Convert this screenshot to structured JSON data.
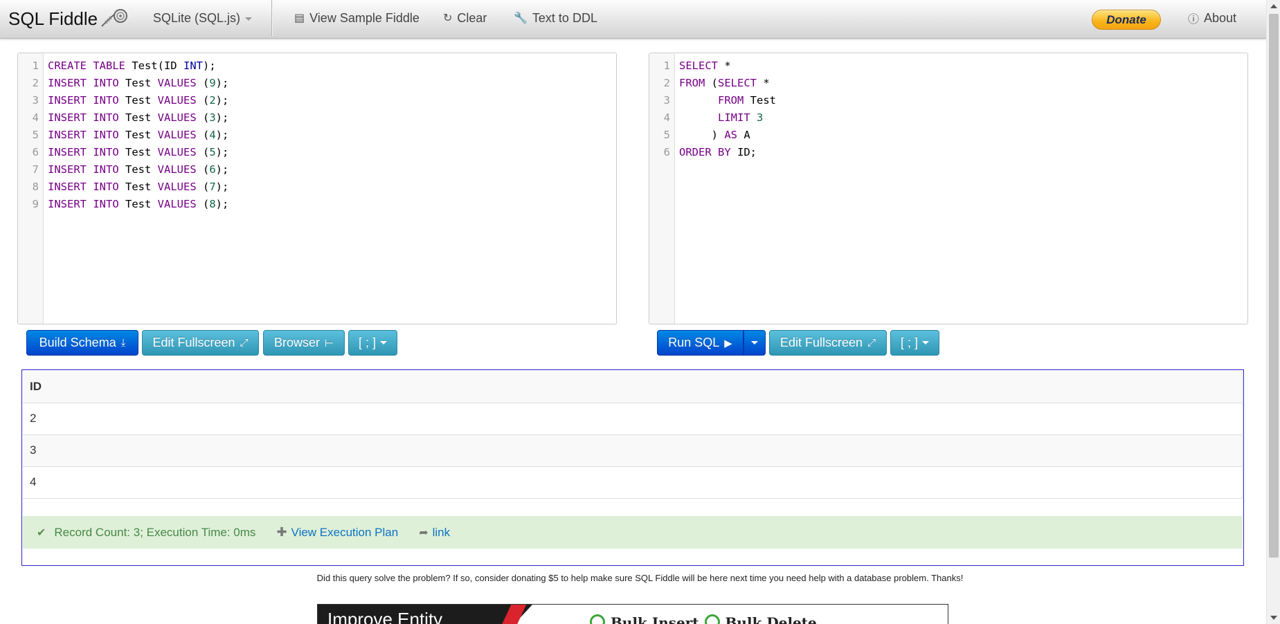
{
  "navbar": {
    "brand": "SQL Fiddle",
    "db_select": "SQLite (SQL.js)",
    "view_sample": "View Sample Fiddle",
    "clear": "Clear",
    "text_to_ddl": "Text to DDL",
    "donate": "Donate",
    "about": "About"
  },
  "schema_editor": {
    "lines": [
      "1",
      "2",
      "3",
      "4",
      "5",
      "6",
      "7",
      "8",
      "9"
    ]
  },
  "query_editor": {
    "lines": [
      "1",
      "2",
      "3",
      "4",
      "5",
      "6"
    ]
  },
  "schema_buttons": {
    "build": "Build Schema",
    "fullscreen": "Edit Fullscreen",
    "browser": "Browser",
    "terminator": "[ ; ]"
  },
  "query_buttons": {
    "run": "Run SQL",
    "fullscreen": "Edit Fullscreen",
    "terminator": "[ ; ]"
  },
  "results": {
    "header": "ID",
    "rows": [
      "2",
      "3",
      "4"
    ],
    "status": "Record Count: 3; Execution Time: 0ms",
    "execution_plan": "View Execution Plan",
    "link": "link"
  },
  "footnote": "Did this query solve the problem? If so, consider donating $5 to help make sure SQL Fiddle will be here next time you need help with a database problem. Thanks!",
  "ad": {
    "headline": "Improve Entity",
    "right_a": "Bulk Insert",
    "right_b": "Bulk Delete"
  }
}
